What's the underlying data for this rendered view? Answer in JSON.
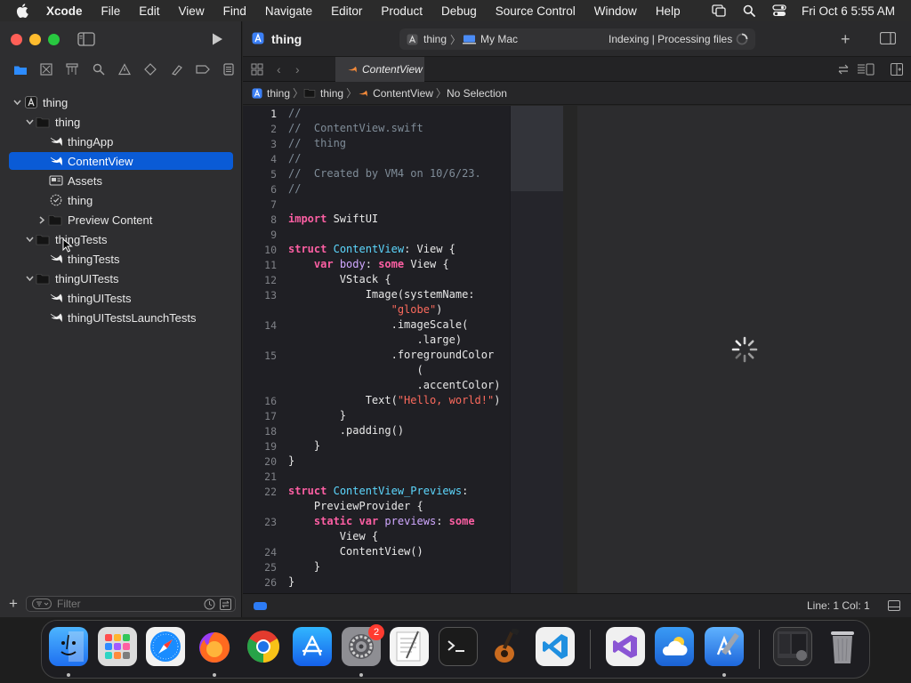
{
  "menubar": {
    "app_name": "Xcode",
    "items": [
      "File",
      "Edit",
      "View",
      "Find",
      "Navigate",
      "Editor",
      "Product",
      "Debug",
      "Source Control",
      "Window",
      "Help"
    ],
    "clock": "Fri Oct 6  5:55 AM"
  },
  "toolbar": {
    "title": "thing",
    "scheme_project": "thing",
    "scheme_destination": "My Mac",
    "activity": "Indexing | Processing files"
  },
  "tab": {
    "label": "ContentView"
  },
  "jumpbar": {
    "project": "thing",
    "group": "thing",
    "file": "ContentView",
    "selection": "No Selection"
  },
  "navigator": {
    "items": [
      {
        "label": "thing",
        "level": 0,
        "icon": "xcode-project-icon",
        "expanded": true
      },
      {
        "label": "thing",
        "level": 1,
        "icon": "folder-icon",
        "expanded": true
      },
      {
        "label": "thingApp",
        "level": 2,
        "icon": "swift-file-icon"
      },
      {
        "label": "ContentView",
        "level": 2,
        "icon": "swift-file-icon",
        "selected": true
      },
      {
        "label": "Assets",
        "level": 2,
        "icon": "asset-catalog-icon"
      },
      {
        "label": "thing",
        "level": 2,
        "icon": "entitlements-icon"
      },
      {
        "label": "Preview Content",
        "level": 2,
        "icon": "folder-icon",
        "collapsed": true
      },
      {
        "label": "thingTests",
        "level": 1,
        "icon": "folder-icon",
        "expanded": true
      },
      {
        "label": "thingTests",
        "level": 2,
        "icon": "swift-file-icon"
      },
      {
        "label": "thingUITests",
        "level": 1,
        "icon": "folder-icon",
        "expanded": true
      },
      {
        "label": "thingUITests",
        "level": 2,
        "icon": "swift-file-icon"
      },
      {
        "label": "thingUITestsLaunchTests",
        "level": 2,
        "icon": "swift-file-icon"
      }
    ],
    "filter_placeholder": "Filter"
  },
  "editor": {
    "lines": [
      {
        "n": "1",
        "code": "//"
      },
      {
        "n": "2",
        "code": "//  ContentView.swift"
      },
      {
        "n": "3",
        "code": "//  thing"
      },
      {
        "n": "4",
        "code": "//"
      },
      {
        "n": "5",
        "code": "//  Created by VM4 on 10/6/23."
      },
      {
        "n": "6",
        "code": "//"
      },
      {
        "n": "7",
        "code": ""
      },
      {
        "n": "8",
        "code": "import SwiftUI"
      },
      {
        "n": "9",
        "code": ""
      },
      {
        "n": "10",
        "code": "struct ContentView: View {"
      },
      {
        "n": "11",
        "code": "    var body: some View {"
      },
      {
        "n": "12",
        "code": "        VStack {"
      },
      {
        "n": "13",
        "code": "            Image(systemName:"
      },
      {
        "n": "",
        "code": "                \"globe\")"
      },
      {
        "n": "14",
        "code": "                .imageScale("
      },
      {
        "n": "",
        "code": "                    .large)"
      },
      {
        "n": "15",
        "code": "                .foregroundColor"
      },
      {
        "n": "",
        "code": "                    ("
      },
      {
        "n": "",
        "code": "                    .accentColor)"
      },
      {
        "n": "16",
        "code": "            Text(\"Hello, world!\")"
      },
      {
        "n": "17",
        "code": "        }"
      },
      {
        "n": "18",
        "code": "        .padding()"
      },
      {
        "n": "19",
        "code": "    }"
      },
      {
        "n": "20",
        "code": "}"
      },
      {
        "n": "21",
        "code": ""
      },
      {
        "n": "22",
        "code": "struct ContentView_Previews:"
      },
      {
        "n": "",
        "code": "    PreviewProvider {"
      },
      {
        "n": "23",
        "code": "    static var previews: some"
      },
      {
        "n": "",
        "code": "        View {"
      },
      {
        "n": "24",
        "code": "        ContentView()"
      },
      {
        "n": "25",
        "code": "    }"
      },
      {
        "n": "26",
        "code": "}"
      }
    ]
  },
  "status": {
    "position": "Line: 1  Col: 1"
  },
  "dock": {
    "badge_settings": "2"
  },
  "colors": {
    "accent": "#0a5bd6",
    "keyword": "#fc5fa3",
    "type": "#5dd8ff",
    "string": "#fc6a5d",
    "comment": "#7f8c98"
  }
}
